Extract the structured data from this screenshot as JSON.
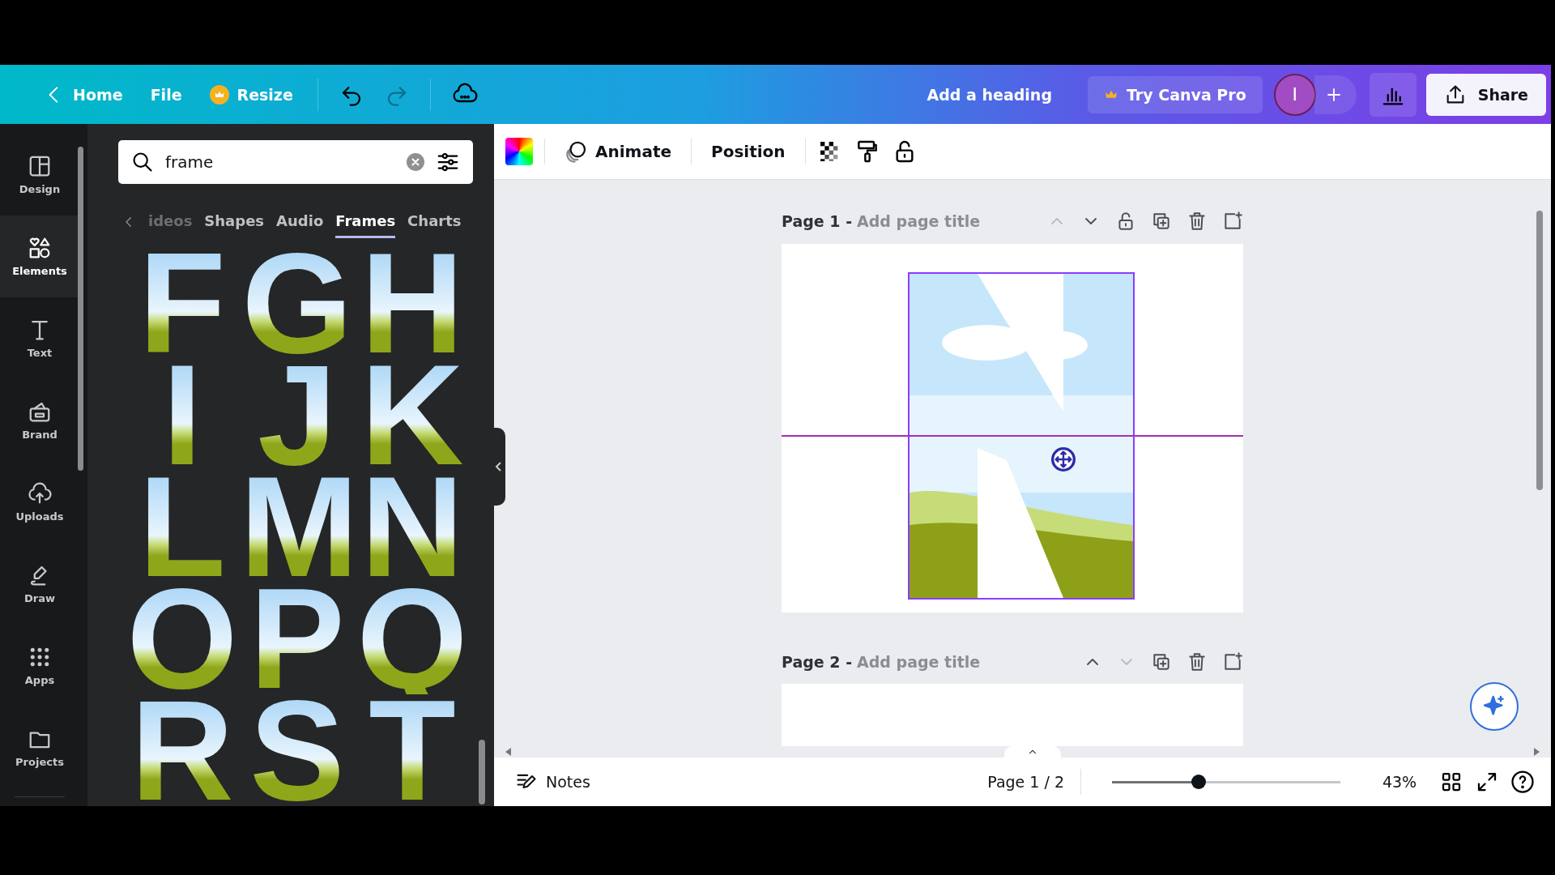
{
  "topbar": {
    "menu": [
      {
        "label": "Home",
        "kind": "back"
      },
      {
        "label": "File",
        "kind": "plain"
      },
      {
        "label": "Resize",
        "kind": "crown"
      }
    ],
    "undo": {
      "disabled": false
    },
    "redo": {
      "disabled": true
    },
    "heading": "Add a heading",
    "pro_button": "Try Canva Pro",
    "avatar": "I",
    "share": "Share"
  },
  "rail": [
    {
      "label": "Design",
      "selected": false
    },
    {
      "label": "Elements",
      "selected": true
    },
    {
      "label": "Text",
      "selected": false
    },
    {
      "label": "Brand",
      "selected": false
    },
    {
      "label": "Uploads",
      "selected": false
    },
    {
      "label": "Draw",
      "selected": false
    },
    {
      "label": "Apps",
      "selected": false
    },
    {
      "label": "Projects",
      "selected": false
    }
  ],
  "search": {
    "value": "frame"
  },
  "categories": [
    {
      "label": "ideos",
      "selected": false
    },
    {
      "label": "Shapes",
      "selected": false
    },
    {
      "label": "Audio",
      "selected": false
    },
    {
      "label": "Frames",
      "selected": true
    },
    {
      "label": "Charts",
      "selected": false
    }
  ],
  "frames": [
    {
      "letter": "F"
    },
    {
      "letter": "G"
    },
    {
      "letter": "H"
    },
    {
      "letter": "I"
    },
    {
      "letter": "J"
    },
    {
      "letter": "K"
    },
    {
      "letter": "L"
    },
    {
      "letter": "M"
    },
    {
      "letter": "N"
    },
    {
      "letter": "O"
    },
    {
      "letter": "P"
    },
    {
      "letter": "Q"
    },
    {
      "letter": "R"
    },
    {
      "letter": "S"
    },
    {
      "letter": "T"
    }
  ],
  "toolbar": {
    "animate": "Animate",
    "position": "Position"
  },
  "pages": [
    {
      "label": "Page 1 -",
      "title_placeholder": "Add page title",
      "up_disabled": true,
      "down_disabled": false,
      "lock": true,
      "kind": "frame"
    },
    {
      "label": "Page 2 -",
      "title_placeholder": "Add page title",
      "up_disabled": false,
      "down_disabled": true,
      "lock": false,
      "kind": "blank"
    }
  ],
  "footer": {
    "notes": "Notes",
    "page_indicator": "Page 1 / 2",
    "zoom": {
      "level": 0.38
    },
    "zoom_label": "43%"
  }
}
